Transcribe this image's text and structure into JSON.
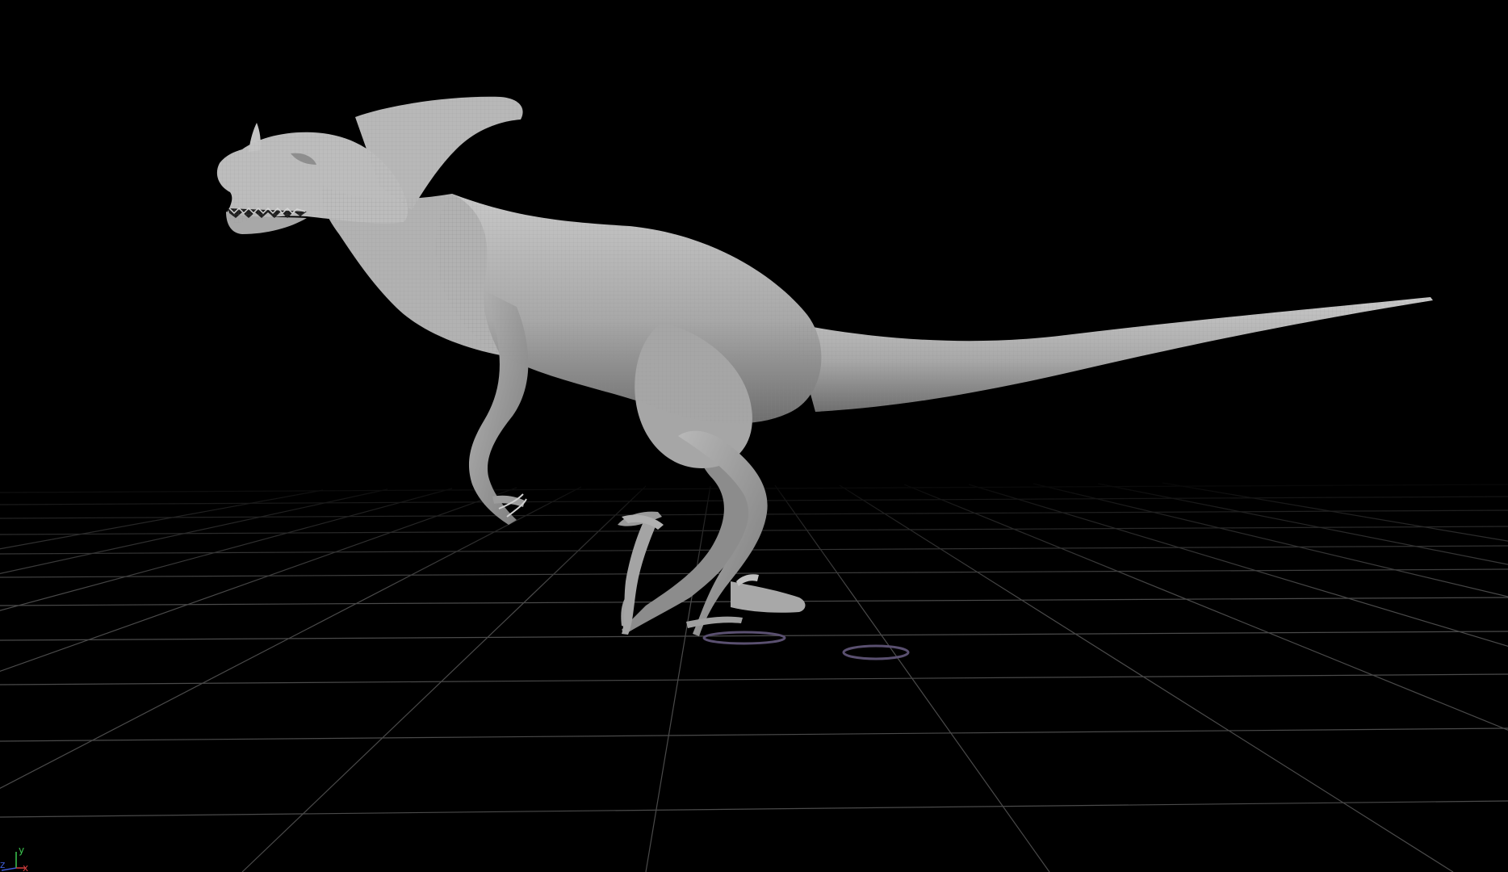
{
  "viewport": {
    "background": "#000000",
    "grid_color": "#4a4a4a",
    "model_color": "#b4b4b4",
    "model_shadow": "#5a5a5a",
    "axis_gizmo": {
      "x_label": "x",
      "y_label": "y",
      "z_label": "z",
      "x_color": "#d23c3c",
      "y_color": "#3cc850",
      "z_color": "#3c5ad2",
      "icon": "axis-gizmo-icon"
    }
  }
}
